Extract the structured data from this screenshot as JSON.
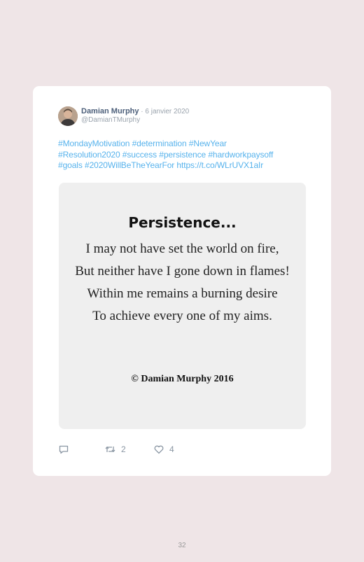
{
  "tweet": {
    "author_name": "Damian Murphy",
    "date_separator": " · ",
    "date": "6 janvier 2020",
    "handle": "@DamianTMurphy",
    "text_lines": [
      "#MondayMotivation #determination #NewYear",
      "#Resolution2020 #success #persistence #hardworkpaysoff",
      "#goals #2020WillBeTheYearFor https://t.co/WLrUVX1aIr"
    ],
    "media": {
      "title": "Persistence...",
      "lines": [
        "I may not have set the world on fire,",
        "But neither have I gone down in flames!",
        "Within me remains a burning desire",
        "To achieve every one of my aims."
      ],
      "copyright": "© Damian Murphy 2016"
    },
    "actions": {
      "reply_icon": "reply-icon",
      "retweet_icon": "retweet-icon",
      "retweet_count": "2",
      "like_icon": "heart-icon",
      "like_count": "4"
    }
  },
  "page": {
    "number": "32"
  },
  "colors": {
    "background": "#efe5e7",
    "card": "#ffffff",
    "link": "#56b2ec",
    "name": "#4c5f7a",
    "muted": "#9aa3ad"
  }
}
